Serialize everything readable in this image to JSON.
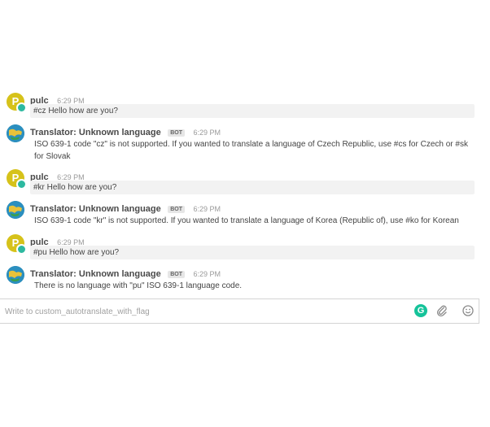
{
  "messages": [
    {
      "author": "pulc",
      "avatar_letter": "P",
      "time": "6:29 PM",
      "text": "#cz Hello how are you?",
      "bot": false
    },
    {
      "author": "Translator: Unknown language",
      "badge": "BOT",
      "time": "6:29 PM",
      "text": "ISO 639-1 code \"cz\" is not supported. If you wanted to translate a language of Czech Republic, use #cs for Czech or #sk for Slovak",
      "bot": true
    },
    {
      "author": "pulc",
      "avatar_letter": "P",
      "time": "6:29 PM",
      "text": "#kr Hello how are you?",
      "bot": false
    },
    {
      "author": "Translator: Unknown language",
      "badge": "BOT",
      "time": "6:29 PM",
      "text": "ISO 639-1 code \"kr\" is not supported. If you wanted to translate a language of Korea (Republic of), use #ko for Korean",
      "bot": true
    },
    {
      "author": "pulc",
      "avatar_letter": "P",
      "time": "6:29 PM",
      "text": "#pu Hello how are you?",
      "bot": false
    },
    {
      "author": "Translator: Unknown language",
      "badge": "BOT",
      "time": "6:29 PM",
      "text": "There is no language with \"pu\" ISO 639-1 language code.",
      "bot": true
    }
  ],
  "composer": {
    "placeholder": "Write to custom_autotranslate_with_flag",
    "grammarly_icon": "grammarly-icon",
    "attach_icon": "paperclip-icon",
    "emoji_icon": "emoji-icon"
  },
  "colors": {
    "accent": "#15c39a",
    "user_avatar": "#d6c21a",
    "status": "#2db9a0"
  }
}
